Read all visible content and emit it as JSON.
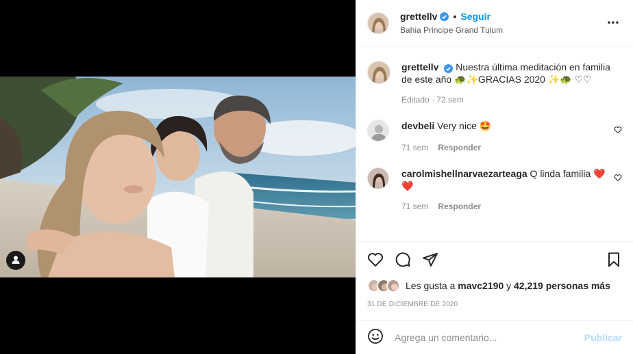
{
  "post": {
    "author": "grettellv",
    "follow_label": "Seguir",
    "separator": "•",
    "location": "Bahia Principe Grand Tulum",
    "more_icon": "more-horizontal-icon"
  },
  "caption": {
    "author": "grettellv",
    "text": "Nuestra última meditación en familia de este año 🐢✨GRACIAS 2020 ✨🐢 ♡♡",
    "meta": "Editado · 72 sem"
  },
  "comments": [
    {
      "author": "devbeli",
      "text": "Very nice 🤩",
      "time": "71 sem",
      "reply": "Responder"
    },
    {
      "author": "carolmishellnarvaezarteaga",
      "text": "Q linda familia ❤️ ❤️",
      "time": "71 sem",
      "reply": "Responder"
    }
  ],
  "likes": {
    "prefix": "Les gusta a",
    "user": "mavc2190",
    "middle": "y",
    "count": "42,219 personas más"
  },
  "date": "31 DE DICIEMBRE DE 2020",
  "comment_box": {
    "placeholder": "Agrega un comentario...",
    "publish": "Publicar"
  },
  "colors": {
    "link": "#0095f6",
    "publish_disabled": "#b3dbff",
    "verified": "#3897f0",
    "heart": "#ed4956"
  }
}
